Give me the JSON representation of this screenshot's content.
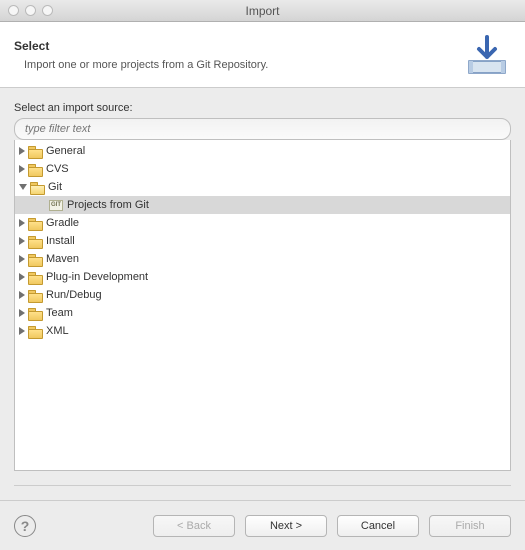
{
  "window": {
    "title": "Import"
  },
  "banner": {
    "heading": "Select",
    "description": "Import one or more projects from a Git Repository."
  },
  "source": {
    "label": "Select an import source:",
    "filter_placeholder": "type filter text"
  },
  "tree": {
    "items": [
      {
        "label": "General",
        "expanded": false,
        "depth": 1,
        "type": "folder"
      },
      {
        "label": "CVS",
        "expanded": false,
        "depth": 1,
        "type": "folder"
      },
      {
        "label": "Git",
        "expanded": true,
        "depth": 1,
        "type": "folder"
      },
      {
        "label": "Projects from Git",
        "expanded": null,
        "depth": 2,
        "type": "git",
        "selected": true
      },
      {
        "label": "Gradle",
        "expanded": false,
        "depth": 1,
        "type": "folder"
      },
      {
        "label": "Install",
        "expanded": false,
        "depth": 1,
        "type": "folder"
      },
      {
        "label": "Maven",
        "expanded": false,
        "depth": 1,
        "type": "folder"
      },
      {
        "label": "Plug-in Development",
        "expanded": false,
        "depth": 1,
        "type": "folder"
      },
      {
        "label": "Run/Debug",
        "expanded": false,
        "depth": 1,
        "type": "folder"
      },
      {
        "label": "Team",
        "expanded": false,
        "depth": 1,
        "type": "folder"
      },
      {
        "label": "XML",
        "expanded": false,
        "depth": 1,
        "type": "folder"
      }
    ]
  },
  "buttons": {
    "back": "< Back",
    "next": "Next >",
    "cancel": "Cancel",
    "finish": "Finish"
  }
}
